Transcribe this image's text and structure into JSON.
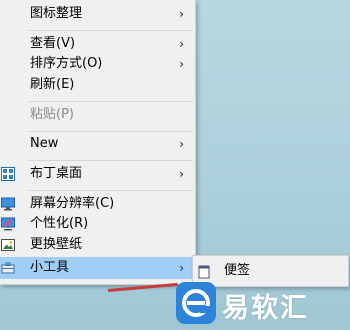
{
  "colors": {
    "highlight": "#9fcff7",
    "menu_bg": "#f0f0f0",
    "disabled_text": "#8a8a8a",
    "watermark_badge": "#2c83d8"
  },
  "context_menu": {
    "items": [
      {
        "label": "图标整理",
        "submenu_arrow": "›"
      },
      {
        "label": "查看(V)",
        "submenu_arrow": "›"
      },
      {
        "label": "排序方式(O)",
        "submenu_arrow": "›"
      },
      {
        "label": "刷新(E)"
      },
      {
        "label": "粘贴(P)",
        "disabled": true
      },
      {
        "label": "New",
        "submenu_arrow": "›"
      },
      {
        "label": "布丁桌面",
        "icon": "app-grid-icon",
        "submenu_arrow": "›"
      },
      {
        "label": "屏幕分辨率(C)",
        "icon": "monitor-icon"
      },
      {
        "label": "个性化(R)",
        "icon": "personalize-icon"
      },
      {
        "label": "更换壁纸",
        "icon": "wallpaper-icon"
      },
      {
        "label": "小工具",
        "icon": "toolbox-icon",
        "submenu_arrow": "›",
        "highlighted": true
      }
    ]
  },
  "submenu": {
    "items": [
      {
        "label": "便签",
        "icon": "sticky-note-icon"
      }
    ]
  },
  "watermark": {
    "text": "易软汇",
    "logo_letter": "e"
  }
}
